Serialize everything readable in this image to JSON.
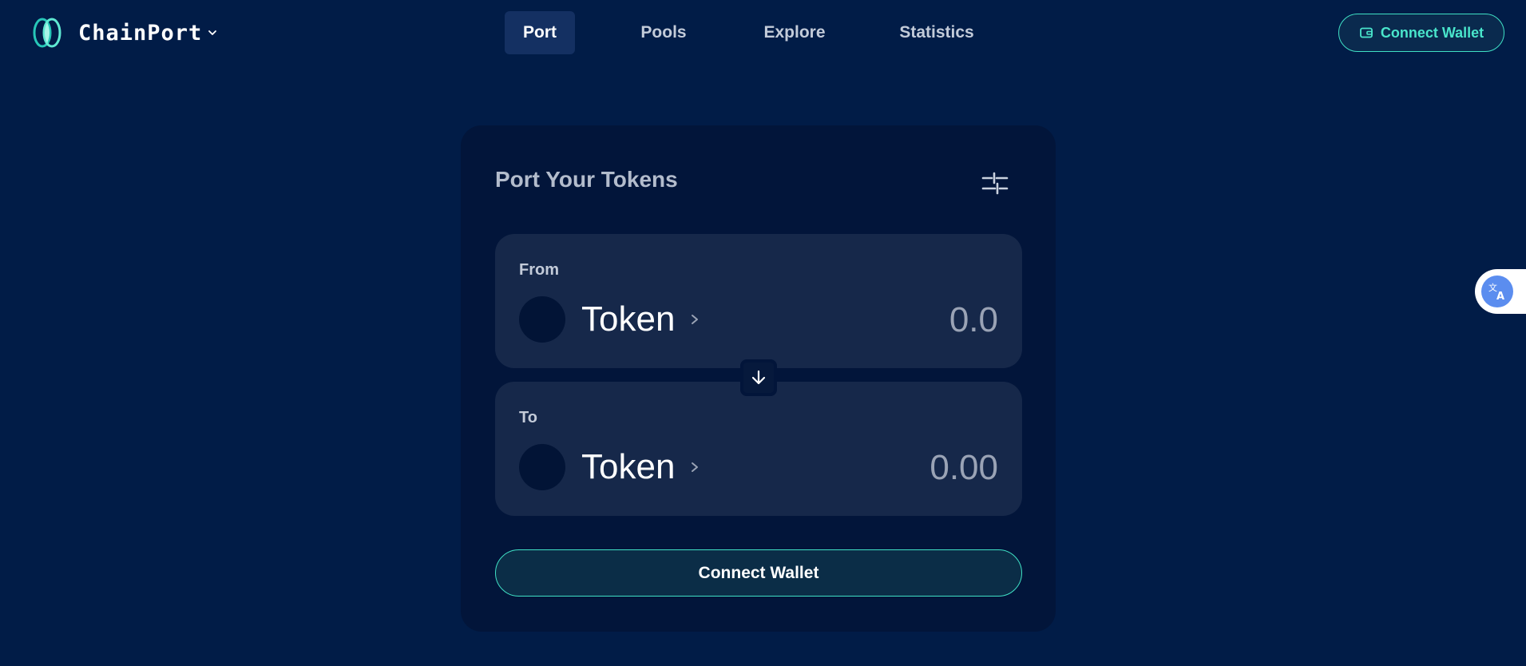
{
  "header": {
    "brand": "ChainPort",
    "nav": [
      {
        "label": "Port",
        "active": true
      },
      {
        "label": "Pools",
        "active": false
      },
      {
        "label": "Explore",
        "active": false
      },
      {
        "label": "Statistics",
        "active": false
      }
    ],
    "connect_label": "Connect Wallet"
  },
  "card": {
    "title": "Port Your Tokens",
    "from": {
      "label": "From",
      "token_label": "Token",
      "amount_placeholder": "0.0"
    },
    "to": {
      "label": "To",
      "token_label": "Token",
      "amount_placeholder": "0.00"
    },
    "connect_label": "Connect Wallet"
  },
  "icons": {
    "logo": "chainport-logo-icon",
    "brand_dropdown": "chevron-down-icon",
    "wallet": "wallet-icon",
    "settings": "sliders-icon",
    "token_chevron": "chevron-right-icon",
    "swap": "arrow-down-icon",
    "translate": "translate-icon"
  },
  "colors": {
    "background": "#011c47",
    "card": "#02153a",
    "panel": "#16284a",
    "accent": "#3fe0c5",
    "nav_active": "#143062"
  }
}
